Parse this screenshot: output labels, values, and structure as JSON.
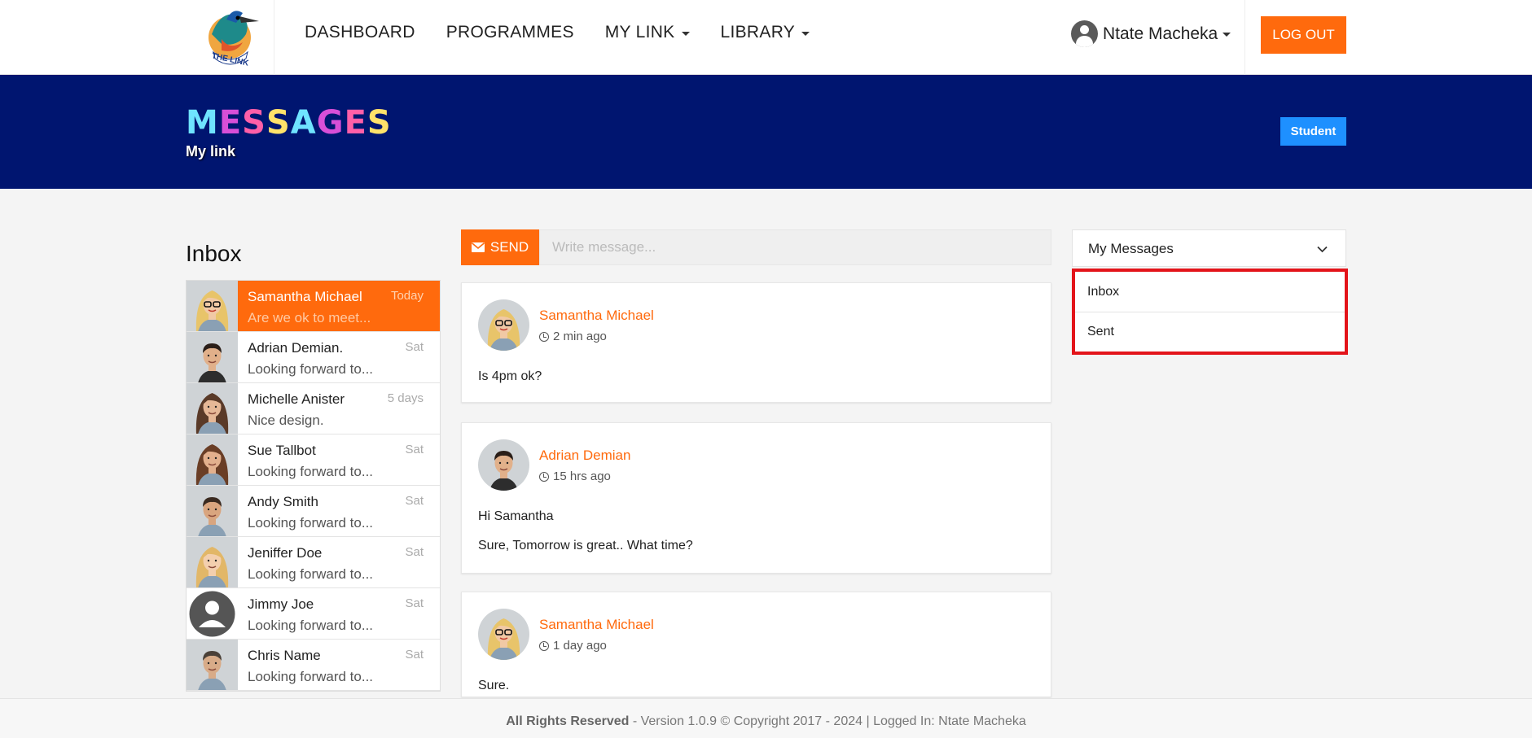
{
  "navbar": {
    "logo_text": "THE LINK",
    "links": [
      {
        "label": "DASHBOARD",
        "dropdown": false
      },
      {
        "label": "PROGRAMMES",
        "dropdown": false
      },
      {
        "label": "MY LINK",
        "dropdown": true
      },
      {
        "label": "LIBRARY",
        "dropdown": true
      }
    ],
    "user_name": "Ntate Macheka",
    "logout_label": "LOG OUT"
  },
  "banner": {
    "title": "MESSAGES",
    "title_colors": [
      "#6fe3ff",
      "#d84fd8",
      "#ff5fa8",
      "#ffe26a",
      "#6fe3ff",
      "#d84fd8",
      "#ff5fa8",
      "#ffe26a"
    ],
    "subtitle": "My link",
    "role_label": "Student"
  },
  "inbox": {
    "title": "Inbox",
    "conversations": [
      {
        "name": "Samantha Michael",
        "date": "Today",
        "preview": "Are we ok to meet...",
        "active": true,
        "face": "woman-blonde"
      },
      {
        "name": "Adrian Demian.",
        "date": "Sat",
        "preview": "Looking forward to...",
        "active": false,
        "face": "man-dark"
      },
      {
        "name": "Michelle Anister",
        "date": "5 days",
        "preview": "Nice design.",
        "active": false,
        "face": "woman-brown"
      },
      {
        "name": "Sue Tallbot",
        "date": "Sat",
        "preview": "Looking forward to...",
        "active": false,
        "face": "woman-long"
      },
      {
        "name": "Andy Smith",
        "date": "Sat",
        "preview": "Looking forward to...",
        "active": false,
        "face": "man-smile"
      },
      {
        "name": "Jeniffer Doe",
        "date": "Sat",
        "preview": "Looking forward to...",
        "active": false,
        "face": "woman-blonde2"
      },
      {
        "name": "Jimmy Joe",
        "date": "Sat",
        "preview": "Looking forward to...",
        "active": false,
        "face": "placeholder"
      },
      {
        "name": "Chris Name",
        "date": "Sat",
        "preview": "Looking forward to...",
        "active": false,
        "face": "man-grey"
      }
    ]
  },
  "composer": {
    "send_label": "SEND",
    "placeholder": "Write message..."
  },
  "messages": [
    {
      "author": "Samantha Michael",
      "time": "2 min ago",
      "lines": [
        "Is 4pm ok?"
      ],
      "face": "woman-blonde"
    },
    {
      "author": "Adrian Demian",
      "time": "15 hrs ago",
      "lines": [
        "Hi Samantha",
        "Sure, Tomorrow is great.. What time?"
      ],
      "face": "man-dark"
    },
    {
      "author": "Samantha Michael",
      "time": "1 day ago",
      "lines": [
        "Sure."
      ],
      "face": "woman-blonde"
    }
  ],
  "sidebar": {
    "header": "My Messages",
    "folders": [
      "Inbox",
      "Sent"
    ]
  },
  "footer": {
    "bold": "All Rights Reserved",
    "text": " - Version 1.0.9 © Copyright 2017 - 2024 | Logged In: Ntate Macheka"
  }
}
